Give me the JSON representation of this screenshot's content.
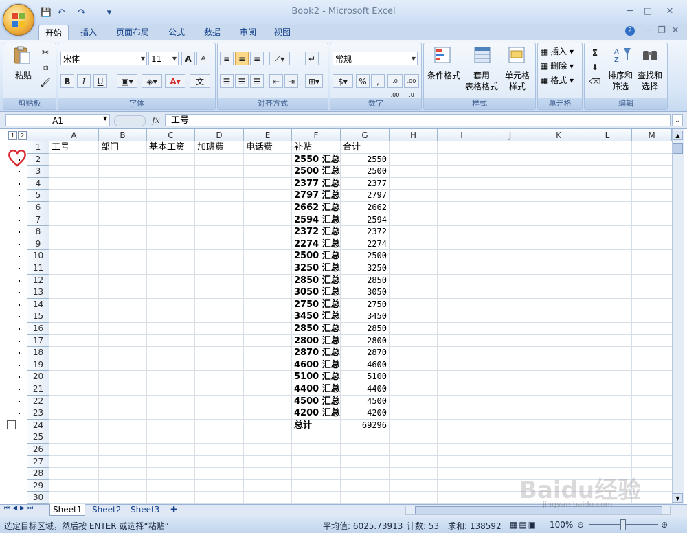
{
  "window": {
    "title": "Book2 - Microsoft Excel"
  },
  "qat": {
    "save": "💾",
    "undo": "↶",
    "redo": "↷",
    "customize": "▾"
  },
  "tabs": [
    "开始",
    "插入",
    "页面布局",
    "公式",
    "数据",
    "审阅",
    "视图"
  ],
  "ribbon": {
    "clipboard": {
      "label": "剪贴板",
      "paste": "粘贴"
    },
    "font": {
      "label": "字体",
      "name": "宋体",
      "size": "11",
      "bold": "B",
      "italic": "I",
      "underline": "U",
      "grow": "A",
      "shrink": "A",
      "color_a": "A",
      "phonetic": "文"
    },
    "alignment": {
      "label": "对齐方式"
    },
    "number": {
      "label": "数字",
      "format": "常规",
      "percent": "%",
      "comma": ",",
      "inc": ".0 .00",
      "dec": ".00 .0"
    },
    "styles": {
      "label": "样式",
      "conditional": "条件格式",
      "table": "套用\n表格格式",
      "cell": "单元格\n样式"
    },
    "cells": {
      "label": "单元格",
      "insert": "插入",
      "delete": "删除",
      "format": "格式"
    },
    "editing": {
      "label": "编辑",
      "sum": "Σ",
      "sort": "排序和\n筛选",
      "find": "查找和\n选择"
    }
  },
  "formula_bar": {
    "name_box": "A1",
    "fx": "fx",
    "value": "工号"
  },
  "outline": {
    "level1": "1",
    "level2": "2",
    "collapse": "−"
  },
  "columns": [
    "A",
    "B",
    "C",
    "D",
    "E",
    "F",
    "G",
    "H",
    "I",
    "J",
    "K",
    "L",
    "M"
  ],
  "rows": [
    "1",
    "2",
    "3",
    "4",
    "5",
    "6",
    "7",
    "8",
    "9",
    "10",
    "11",
    "12",
    "13",
    "14",
    "15",
    "16",
    "17",
    "18",
    "19",
    "20",
    "21",
    "22",
    "23",
    "24",
    "25",
    "26",
    "27",
    "28",
    "29",
    "30"
  ],
  "headers": [
    "工号",
    "部门",
    "基本工资",
    "加班费",
    "电话费",
    "补贴",
    "合计"
  ],
  "data_rows": [
    {
      "f": "2550 汇总",
      "g": "2550"
    },
    {
      "f": "2500 汇总",
      "g": "2500"
    },
    {
      "f": "2377 汇总",
      "g": "2377"
    },
    {
      "f": "2797 汇总",
      "g": "2797"
    },
    {
      "f": "2662 汇总",
      "g": "2662"
    },
    {
      "f": "2594 汇总",
      "g": "2594"
    },
    {
      "f": "2372 汇总",
      "g": "2372"
    },
    {
      "f": "2274 汇总",
      "g": "2274"
    },
    {
      "f": "2500 汇总",
      "g": "2500"
    },
    {
      "f": "3250 汇总",
      "g": "3250"
    },
    {
      "f": "2850 汇总",
      "g": "2850"
    },
    {
      "f": "3050 汇总",
      "g": "3050"
    },
    {
      "f": "2750 汇总",
      "g": "2750"
    },
    {
      "f": "3450 汇总",
      "g": "3450"
    },
    {
      "f": "2850 汇总",
      "g": "2850"
    },
    {
      "f": "2800 汇总",
      "g": "2800"
    },
    {
      "f": "2870 汇总",
      "g": "2870"
    },
    {
      "f": "4600 汇总",
      "g": "4600"
    },
    {
      "f": "5100 汇总",
      "g": "5100"
    },
    {
      "f": "4400 汇总",
      "g": "4400"
    },
    {
      "f": "4500 汇总",
      "g": "4500"
    },
    {
      "f": "4200 汇总",
      "g": "4200"
    }
  ],
  "total_row": {
    "f": "总计",
    "g": "69296"
  },
  "sheet_tabs": [
    "Sheet1",
    "Sheet2",
    "Sheet3"
  ],
  "status": {
    "message": "选定目标区域，然后按 ENTER 或选择“粘贴”",
    "average": "平均值: 6025.73913",
    "count": "计数: 53",
    "sum": "求和: 138592",
    "zoom": "100%"
  },
  "watermark": {
    "text": "Baidu经验",
    "url": "jingyan.baidu.com"
  },
  "colors": {
    "accent": "#15428b",
    "ribbon": "#dbe7f6",
    "heart": "#d9282f"
  }
}
